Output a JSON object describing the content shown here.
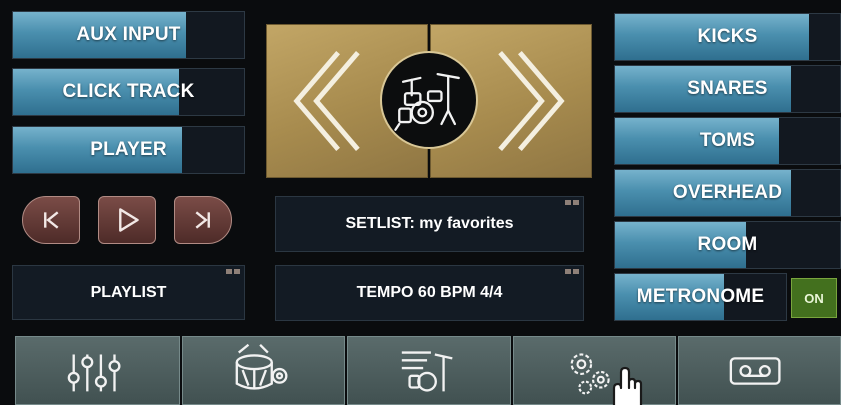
{
  "left_channels": [
    {
      "label": "AUX INPUT",
      "level": 0.75
    },
    {
      "label": "CLICK TRACK",
      "level": 0.72
    },
    {
      "label": "PLAYER",
      "level": 0.73
    }
  ],
  "right_channels": [
    {
      "label": "KICKS",
      "level": 0.86
    },
    {
      "label": "SNARES",
      "level": 0.78
    },
    {
      "label": "TOMS",
      "level": 0.73
    },
    {
      "label": "OVERHEAD",
      "level": 0.78
    },
    {
      "label": "ROOM",
      "level": 0.58
    }
  ],
  "metronome": {
    "label": "METRONOME",
    "level": 0.64,
    "toggle_label": "ON"
  },
  "pad": {
    "prev_icon": "chevron-left-icon",
    "next_icon": "chevron-right-icon",
    "center_icon": "drum-kit-icon"
  },
  "transport": [
    {
      "icon": "skip-back-icon"
    },
    {
      "icon": "play-icon"
    },
    {
      "icon": "skip-forward-icon"
    }
  ],
  "panels": {
    "playlist": "PLAYLIST",
    "setlist": "SETLIST: my favorites",
    "tempo": "TEMPO 60 BPM 4/4"
  },
  "nav": [
    {
      "icon": "mixer-sliders-icon"
    },
    {
      "icon": "drum-settings-icon"
    },
    {
      "icon": "kit-list-icon"
    },
    {
      "icon": "gears-icon"
    },
    {
      "icon": "cassette-icon"
    }
  ],
  "colors": {
    "fader": "#4a8fae",
    "pad": "#a78b4e",
    "transport": "#5a3431",
    "toggle": "#43701e",
    "nav": "#4d5e5e"
  }
}
